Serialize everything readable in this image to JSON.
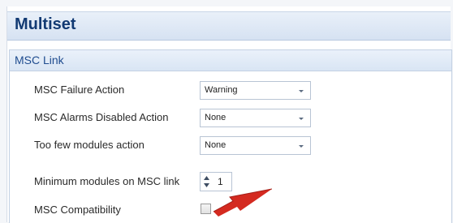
{
  "header": {
    "title": "Multiset"
  },
  "section": {
    "title": "MSC Link"
  },
  "settings": {
    "failure_action": {
      "label": "MSC Failure Action",
      "value": "Warning"
    },
    "alarms_disabled_action": {
      "label": "MSC Alarms Disabled Action",
      "value": "None"
    },
    "too_few_modules_action": {
      "label": "Too few modules action",
      "value": "None"
    },
    "minimum_modules": {
      "label": "Minimum modules on MSC link",
      "value": "1"
    },
    "compatibility": {
      "label": "MSC Compatibility",
      "checked": false
    }
  },
  "colors": {
    "header_text": "#123a73",
    "section_text": "#1f4c8f",
    "annotation_arrow": "#d42a20"
  },
  "icons": {
    "dropdown": "chevron-down-icon",
    "spinner": "up-down-arrows-icon",
    "annotation": "red-pointer-arrow-icon"
  }
}
